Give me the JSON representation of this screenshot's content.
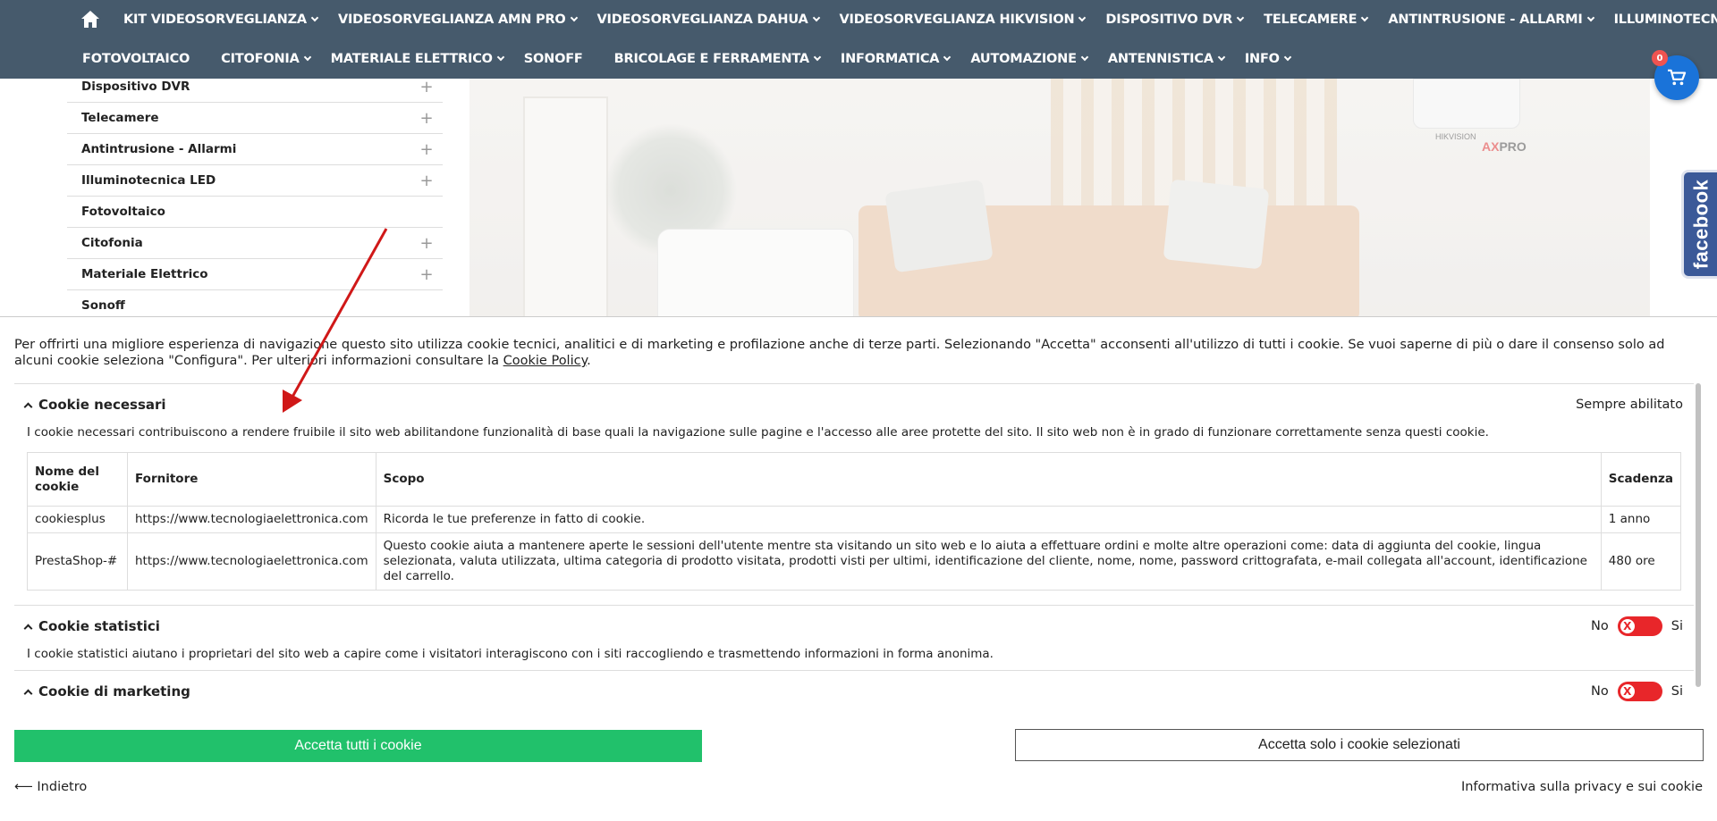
{
  "nav": {
    "row1": [
      "KIT VIDEOSORVEGLIANZA",
      "VIDEOSORVEGLIANZA AMN PRO",
      "VIDEOSORVEGLIANZA DAHUA",
      "VIDEOSORVEGLIANZA HIKVISION",
      "DISPOSITIVO DVR",
      "TELECAMERE",
      "ANTINTRUSIONE - ALLARMI",
      "ILLUMINOTECNICA LED"
    ],
    "row2": [
      "FOTOVOLTAICO",
      "CITOFONIA",
      "MATERIALE ELETTRICO",
      "SONOFF",
      "BRICOLAGE E FERRAMENTA",
      "INFORMATICA",
      "AUTOMAZIONE",
      "ANTENNISTICA",
      "INFO"
    ]
  },
  "cart": {
    "count": "0"
  },
  "sidebar": {
    "items": [
      {
        "label": "Dispositivo DVR",
        "expand": "+"
      },
      {
        "label": "Telecamere",
        "expand": "+"
      },
      {
        "label": "Antintrusione - Allarmi",
        "expand": "+"
      },
      {
        "label": "Illuminotecnica LED",
        "expand": "+"
      },
      {
        "label": "Fotovoltaico",
        "expand": ""
      },
      {
        "label": "Citofonia",
        "expand": "+"
      },
      {
        "label": "Materiale Elettrico",
        "expand": "+"
      },
      {
        "label": "Sonoff",
        "expand": ""
      }
    ]
  },
  "hero": {
    "brand_hub": "HIKVISION",
    "brand_ax": "AX",
    "brand_pro": "PRO"
  },
  "facebook": {
    "label": "facebook"
  },
  "cookie": {
    "intro_text": "Per offrirti una migliore esperienza di navigazione questo sito utilizza cookie tecnici, analitici e di marketing e profilazione anche di terze parti. Selezionando \"Accetta\" acconsenti all'utilizzo di tutti i cookie. Se vuoi saperne di più o dare il consenso solo ad alcuni cookie seleziona \"Configura\". Per ulteriori informazioni consultare la ",
    "policy_link": "Cookie Policy",
    "intro_end": ".",
    "necessary": {
      "title": "Cookie necessari",
      "status": "Sempre abilitato",
      "desc": "I cookie necessari contribuiscono a rendere fruibile il sito web abilitandone funzionalità di base quali la navigazione sulle pagine e l'accesso alle aree protette del sito. Il sito web non è in grado di funzionare correttamente senza questi cookie.",
      "headers": [
        "Nome del cookie",
        "Fornitore",
        "Scopo",
        "Scadenza"
      ],
      "rows": [
        [
          "cookiesplus",
          "https://www.tecnologiaelettronica.com",
          "Ricorda le tue preferenze in fatto di cookie.",
          "1 anno"
        ],
        [
          "PrestaShop-#",
          "https://www.tecnologiaelettronica.com",
          "Questo cookie aiuta a mantenere aperte le sessioni dell'utente mentre sta visitando un sito web e lo aiuta a effettuare ordini e molte altre operazioni come: data di aggiunta del cookie, lingua selezionata, valuta utilizzata, ultima categoria di prodotto visitata, prodotti visti per ultimi, identificazione del cliente, nome, nome, password crittografata, e-mail collegata all'account, identificazione del carrello.",
          "480 ore"
        ]
      ]
    },
    "statistics": {
      "title": "Cookie statistici",
      "no": "No",
      "yes": "Si",
      "knob": "X",
      "desc": "I cookie statistici aiutano i proprietari del sito web a capire come i visitatori interagiscono con i siti raccogliendo e trasmettendo informazioni in forma anonima."
    },
    "marketing": {
      "title": "Cookie di marketing",
      "no": "No",
      "yes": "Si",
      "knob": "X"
    },
    "accept_all": "Accetta tutti i cookie",
    "accept_selected": "Accetta solo i cookie selezionati",
    "back": "⟵ Indietro",
    "privacy": "Informativa sulla privacy e sui cookie"
  }
}
